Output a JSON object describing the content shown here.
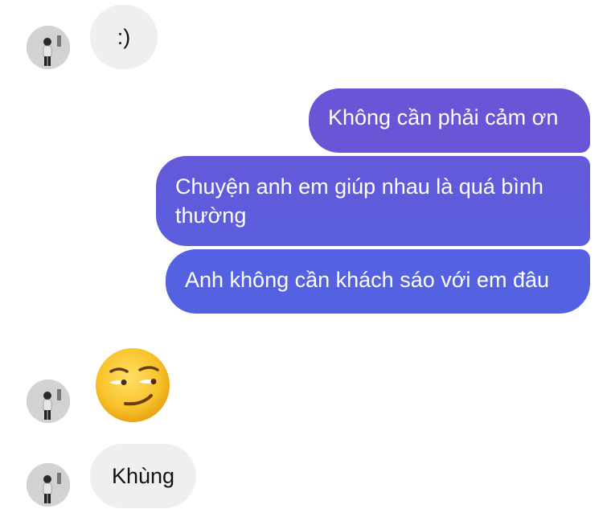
{
  "conversation": {
    "messages": [
      {
        "sender": "them",
        "text": ":)"
      },
      {
        "sender": "me",
        "text": "Không cần phải cảm ơn"
      },
      {
        "sender": "me",
        "text": "Chuyện anh em giúp nhau là quá bình thường"
      },
      {
        "sender": "me",
        "text": "Anh không cần khách sáo với em đâu"
      },
      {
        "sender": "them",
        "emoji": "smirking-face"
      },
      {
        "sender": "them",
        "text": "Khùng"
      }
    ]
  },
  "colors": {
    "outgoing_gradient_top": "#6f53d6",
    "outgoing_gradient_bottom": "#5063e4",
    "incoming_bubble": "#efefef",
    "emoji_face": "#f5bd21"
  }
}
